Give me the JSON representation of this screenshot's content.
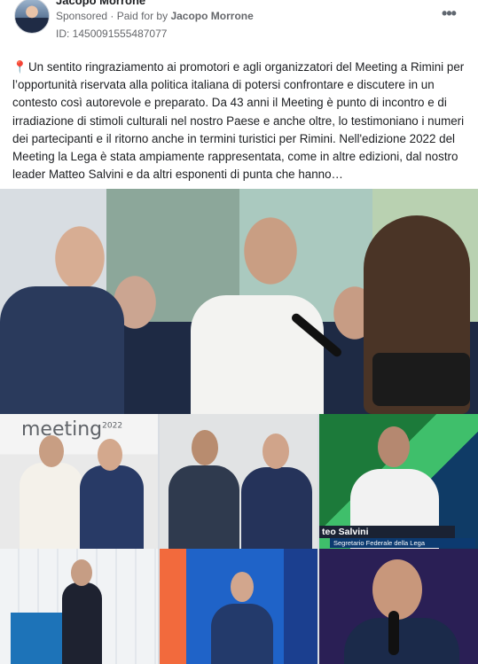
{
  "post": {
    "author": "Jacopo Morrone",
    "sponsored_label": "Sponsored",
    "paid_for_prefix": "Paid for by",
    "paid_for_by": "Jacopo Morrone",
    "ad_id": "ID: 1450091555487077",
    "more_icon": "more-horizontal-icon",
    "pin_emoji": "📍",
    "text": "Un sentito ringraziamento ai promotori e agli organizzatori del Meeting a Rimini per l’opportunità riservata alla politica italiana di potersi confrontare e discutere in un contesto così autorevole e preparato. Da 43 anni il Meeting è punto di incontro e di irradiazione di stimoli culturali nel nostro Paese e anche oltre, lo testimoniano i numeri dei partecipanti e il ritorno anche in termini turistici per Rimini. Nell'edizione 2022 del Meeting la Lega è stata ampiamente rappresentata, come in altre edizioni, dal nostro leader Matteo Salvini e da altri esponenti di punta che hanno…"
  },
  "media": {
    "logo_text": "meeting",
    "logo_year": "2022",
    "lower_third_name": "teo Salvini",
    "lower_third_role": "Segretario Federale della Lega"
  }
}
